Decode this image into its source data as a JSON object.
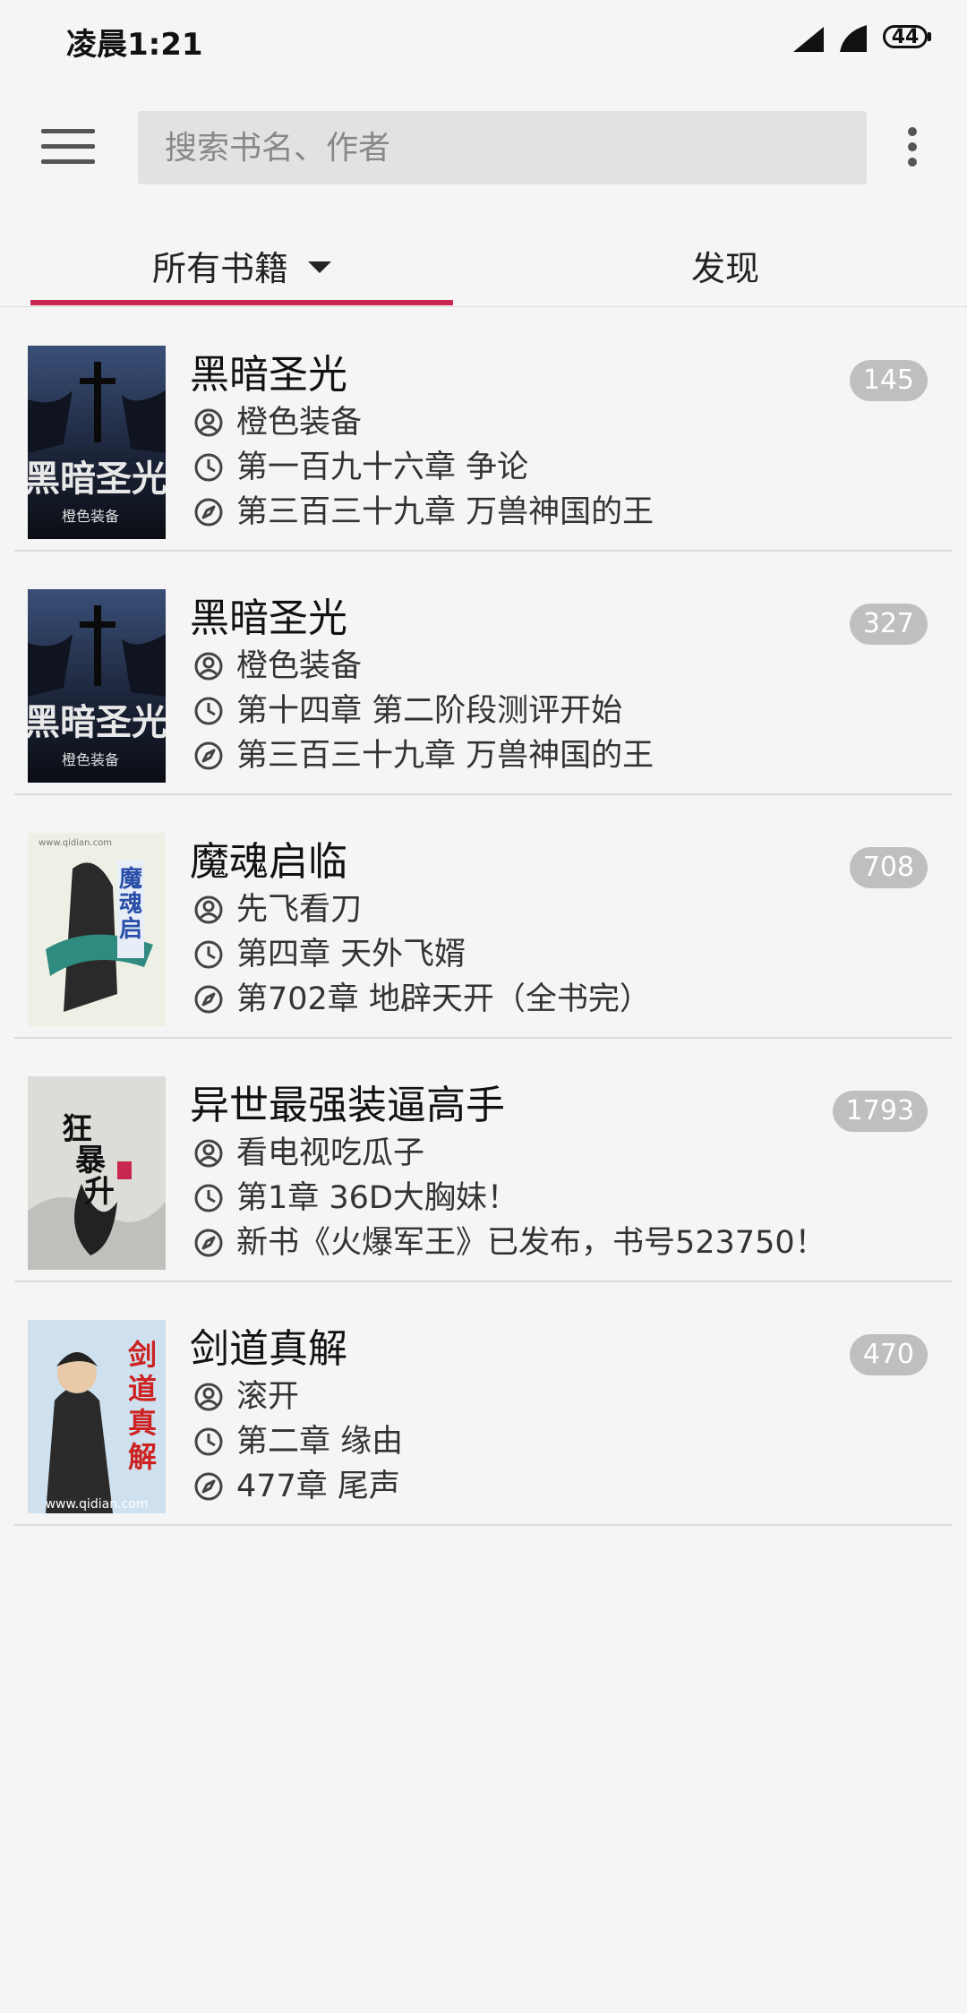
{
  "status_bar": {
    "time": "凌晨1:21",
    "battery": "44",
    "icons": [
      "signal-icon",
      "signal-icon",
      "battery-icon"
    ]
  },
  "toolbar": {
    "search_placeholder": "搜索书名、作者",
    "menu_icon": "hamburger-menu-icon",
    "more_icon": "more-vertical-icon"
  },
  "tabs": [
    {
      "label": "所有书籍",
      "active": true,
      "has_dropdown": true
    },
    {
      "label": "发现",
      "active": false
    }
  ],
  "colors": {
    "accent": "#c8284f",
    "badge": "#bfbfbf",
    "background": "#f5f5f5"
  },
  "books": [
    {
      "title": "黑暗圣光",
      "author": "橙色装备",
      "last_read": "第一百九十六章 争论",
      "latest": "第三百三十九章 万兽神国的王",
      "count": "145",
      "cover": "dark-cross"
    },
    {
      "title": "黑暗圣光",
      "author": "橙色装备",
      "last_read": "第十四章 第二阶段测评开始",
      "latest": "第三百三十九章 万兽神国的王",
      "count": "327",
      "cover": "dark-cross"
    },
    {
      "title": "魔魂启临",
      "author": "先飞看刀",
      "last_read": "第四章 天外飞婿",
      "latest": "第702章 地辟天开（全书完）",
      "count": "708",
      "cover": "warrior"
    },
    {
      "title": "异世最强装逼高手",
      "author": "看电视吃瓜子",
      "last_read": "第1章 36D大胸妹！",
      "latest": "新书《火爆军王》已发布，书号523750！",
      "count": "1793",
      "cover": "ink"
    },
    {
      "title": "剑道真解",
      "author": "滚开",
      "last_read": "第二章 缘由",
      "latest": "477章 尾声",
      "count": "470",
      "cover": "swordsman"
    }
  ]
}
